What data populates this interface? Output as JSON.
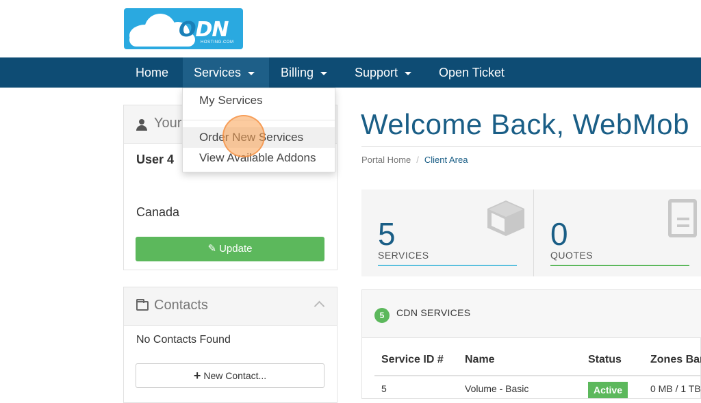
{
  "logo": {
    "text_prefix": "",
    "text_o": "O",
    "text_main": "DN",
    "tagline": "HOSTING.COM"
  },
  "nav": {
    "home": "Home",
    "services": "Services",
    "billing": "Billing",
    "support": "Support",
    "open_ticket": "Open Ticket"
  },
  "dropdown": {
    "my_services": "My Services",
    "order_new": "Order New Services",
    "addons": "View Available Addons"
  },
  "sidebar": {
    "info_title": "Your",
    "user_name": "User 4",
    "country": "Canada",
    "update_label": "Update",
    "contacts_title": "Contacts",
    "no_contacts": "No Contacts Found",
    "new_contact_label": "New Contact..."
  },
  "main": {
    "welcome": "Welcome Back, WebMob",
    "breadcrumb_home": "Portal Home",
    "breadcrumb_sep": "/",
    "breadcrumb_current": "Client Area"
  },
  "tiles": [
    {
      "value": "5",
      "label": "SERVICES",
      "color": "#5bc0de"
    },
    {
      "value": "0",
      "label": "QUOTES",
      "color": "#5cb85c"
    }
  ],
  "services_panel": {
    "count": "5",
    "title": "CDN SERVICES",
    "columns": [
      "Service ID #",
      "Name",
      "Status",
      "Zones Ban"
    ],
    "rows": [
      {
        "id": "5",
        "name": "Volume - Basic",
        "status": "Active",
        "zones": "0 MB / 1 TB"
      }
    ]
  },
  "colors": {
    "navbar": "#0e4c74",
    "accent": "#1a5e86",
    "success": "#5cb85c",
    "logo_bg": "#2aa9e0"
  }
}
